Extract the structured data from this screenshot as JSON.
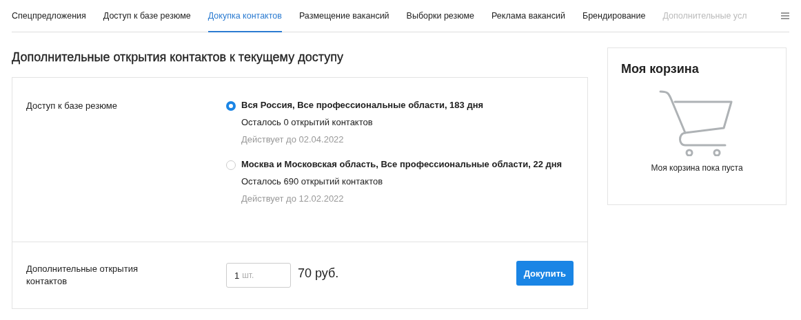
{
  "tabs": [
    {
      "label": "Спецпредложения",
      "selected": false
    },
    {
      "label": "Доступ к базе резюме",
      "selected": false
    },
    {
      "label": "Докупка контактов",
      "selected": true
    },
    {
      "label": "Размещение вакансий",
      "selected": false
    },
    {
      "label": "Выборки резюме",
      "selected": false
    },
    {
      "label": "Реклама вакансий",
      "selected": false
    },
    {
      "label": "Брендирование",
      "selected": false
    },
    {
      "label": "Дополнительные усл",
      "selected": false
    }
  ],
  "heading": "Дополнительные открытия контактов к текущему доступу",
  "access": {
    "label": "Доступ к базе резюме",
    "options": [
      {
        "title": "Вся Россия, Все профессиональные области, 183 дня",
        "remaining": "Осталось 0 открытий контактов",
        "valid_until": "Действует до 02.04.2022",
        "selected": true
      },
      {
        "title": "Москва и Московская область, Все профессиональные области, 22 дня",
        "remaining": "Осталось 690 открытий контактов",
        "valid_until": "Действует до 12.02.2022",
        "selected": false
      }
    ]
  },
  "purchase": {
    "label": "Дополнительные открытия контактов",
    "quantity": "1",
    "unit": "шт.",
    "price": "70 руб.",
    "button": "Докупить"
  },
  "cart": {
    "title": "Моя корзина",
    "empty_text": "Моя корзина пока пуста"
  }
}
